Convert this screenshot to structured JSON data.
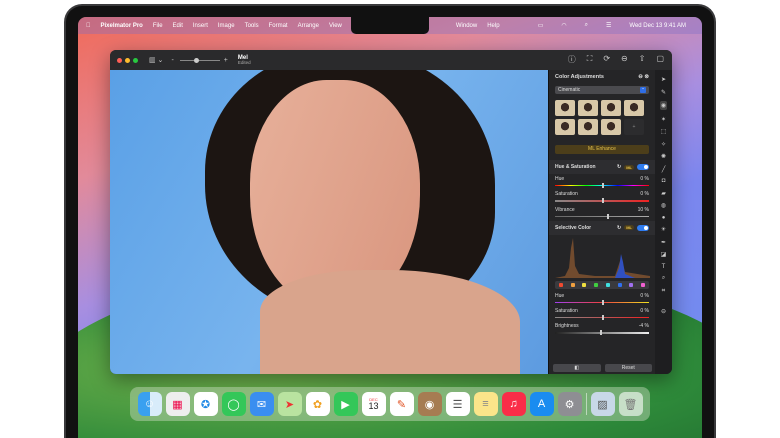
{
  "menubar": {
    "app": "Pixelmator Pro",
    "items": [
      "File",
      "Edit",
      "Insert",
      "Image",
      "Tools",
      "Format",
      "Arrange",
      "View"
    ],
    "items_right": [
      "Window",
      "Help"
    ],
    "clock": "Wed Dec 13  9:41 AM"
  },
  "window": {
    "doc_title": "Mel",
    "doc_status": "Edited"
  },
  "panel": {
    "title": "Color Adjustments",
    "preset": "Cinematic",
    "ml_enhance": "ML Enhance",
    "ml_badge": "ML",
    "hue_sat": {
      "title": "Hue & Saturation",
      "rows": [
        {
          "label": "Hue",
          "value": "0 %",
          "pos": 0.5
        },
        {
          "label": "Saturation",
          "value": "0 %",
          "pos": 0.5
        },
        {
          "label": "Vibrance",
          "value": "10 %",
          "pos": 0.55
        }
      ]
    },
    "selective": {
      "title": "Selective Color",
      "swatches": [
        "#f04a30",
        "#f0a040",
        "#f0e040",
        "#40d040",
        "#40e0e0",
        "#3070f0",
        "#a070f0",
        "#f060d0"
      ],
      "rows": [
        {
          "label": "Hue",
          "value": "0 %",
          "pos": 0.5
        },
        {
          "label": "Saturation",
          "value": "0 %",
          "pos": 0.5
        },
        {
          "label": "Brightness",
          "value": "-4 %",
          "pos": 0.48
        }
      ]
    },
    "reset": "Reset"
  },
  "dock": {
    "calendar_month": "DEC",
    "calendar_day": "13"
  }
}
